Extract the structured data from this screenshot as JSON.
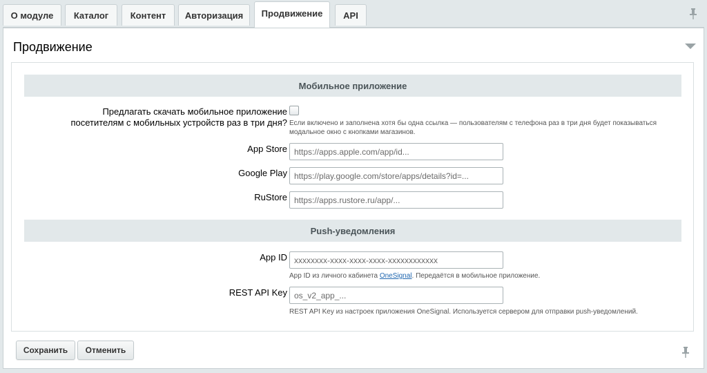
{
  "tabs": [
    {
      "label": "О модуле"
    },
    {
      "label": "Каталог"
    },
    {
      "label": "Контент"
    },
    {
      "label": "Авторизация"
    },
    {
      "label": "Продвижение",
      "active": true
    },
    {
      "label": "API"
    }
  ],
  "page": {
    "title": "Продвижение"
  },
  "mobile_section": {
    "heading": "Мобильное приложение",
    "offer_label": "Предлагать скачать мобильное приложение посетителям с мобильных устройств раз в три дня?",
    "offer_checked": false,
    "offer_hint": "Если включено и заполнена хотя бы одна ссылка — пользователям с телефона раз в три дня будет показываться модальное окно с кнопками магазинов.",
    "app_store_label": "App Store",
    "app_store_placeholder": "https://apps.apple.com/app/id...",
    "google_play_label": "Google Play",
    "google_play_placeholder": "https://play.google.com/store/apps/details?id=...",
    "rustore_label": "RuStore",
    "rustore_placeholder": "https://apps.rustore.ru/app/..."
  },
  "push_section": {
    "heading": "Push-уведомления",
    "app_id_label": "App ID",
    "app_id_placeholder": "xxxxxxxx-xxxx-xxxx-xxxx-xxxxxxxxxxxx",
    "app_id_hint_before": "App ID из личного кабинета ",
    "app_id_hint_link": "OneSignal",
    "app_id_hint_after": ". Передаётся в мобильное приложение.",
    "rest_key_label": "REST API Key",
    "rest_key_placeholder": "os_v2_app_...",
    "rest_key_hint": "REST API Key из настроек приложения OneSignal. Используется сервером для отправки push-уведомлений."
  },
  "footer": {
    "save_label": "Сохранить",
    "cancel_label": "Отменить"
  },
  "colors": {
    "background": "#e2e8ea",
    "section_header": "#e2e8ea",
    "link": "#2067b0"
  },
  "icons": {
    "pin": "pin-icon",
    "collapse": "triangle-down-icon"
  }
}
